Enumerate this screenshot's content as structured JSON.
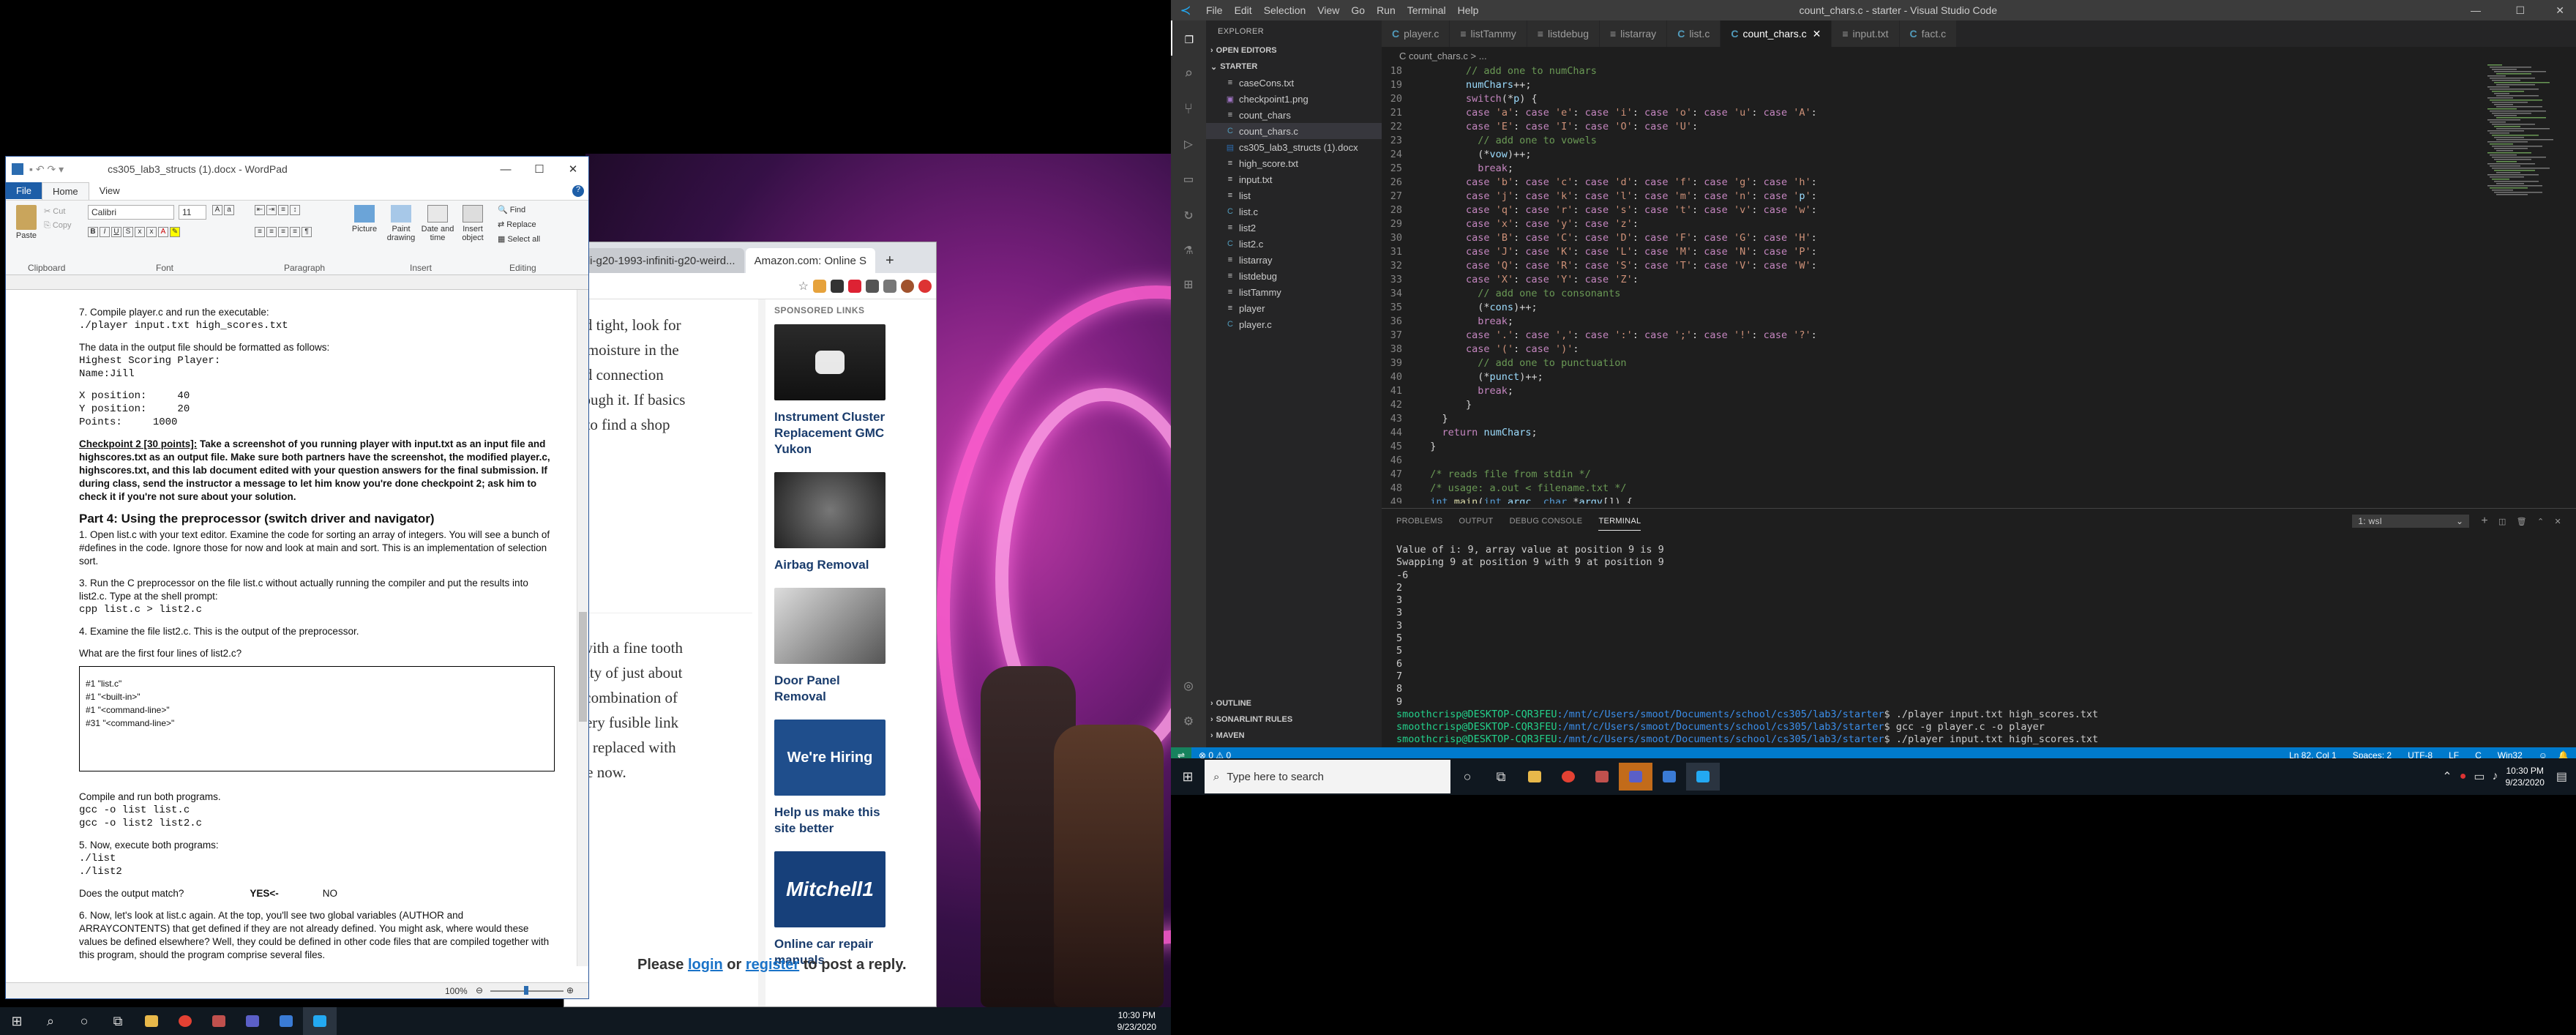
{
  "wordpad": {
    "title": "cs305_lab3_structs (1).docx - WordPad",
    "tabs": [
      "File",
      "Home",
      "View"
    ],
    "clipboard": {
      "paste": "Paste",
      "cut": "Cut",
      "copy": "Copy",
      "label": "Clipboard"
    },
    "font": {
      "family": "Calibri",
      "size": "11",
      "label": "Font"
    },
    "paragraph_label": "Paragraph",
    "insert": {
      "picture": "Picture",
      "paint": "Paint drawing",
      "datetime": "Date and time",
      "object": "Insert object",
      "label": "Insert"
    },
    "editing": {
      "find": "Find",
      "replace": "Replace",
      "select_all": "Select all",
      "label": "Editing"
    },
    "zoom": "100%",
    "doc": {
      "l1": "7. Compile player.c and run the executable:",
      "l2": "./player input.txt high_scores.txt",
      "l3": "The data in the output file should be formatted as follows:",
      "l4": "Highest Scoring Player:",
      "l5": "Name:Jill",
      "l6": "X position:     40",
      "l7": "Y position:     20",
      "l8": "Points:     1000",
      "cp_head": "Checkpoint 2 [30 points]:",
      "cp_body": " Take a screenshot of you running player with input.txt as an input file and highscores.txt as an output file. Make sure both partners have the screenshot, the modified player.c, highscores.txt, and this lab document edited with your question answers for the final submission. If during class, send the instructor a message to let him know you're done checkpoint 2; ask him to check it if you're not sure about your solution.",
      "part4": "Part 4: Using the preprocessor (switch driver and navigator)",
      "s1": "1. Open list.c with your text editor. Examine the code for sorting an array of integers. You will see a bunch of #defines in the code. Ignore those for now and look at main and sort. This is an implementation of selection sort.",
      "s3": "3. Run the C preprocessor on the file list.c without actually running the compiler and put the results into list2.c. Type at the shell prompt:",
      "s3cmd": "cpp list.c > list2.c",
      "s4": "4. Examine the file list2.c. This is the output of the preprocessor.",
      "q": "What are the first four lines of list2.c?",
      "ans": [
        "#1 \"list.c\"",
        "#1 \"<built-in>\"",
        "#1 \"<command-line>\"",
        "#31 \"<command-line>\""
      ],
      "compile": "Compile and run both programs.",
      "gcc1": "gcc -o list list.c",
      "gcc2": "gcc -o list2 list2.c",
      "s5": "5. Now, execute both programs:",
      "run1": "./list",
      "run2": "./list2",
      "match": "Does the output match?",
      "yes": "YES<-",
      "no": "NO",
      "s6": "6. Now, let's look at list.c again. At the top, you'll see two global variables (AUTHOR and ARRAYCONTENTS) that get defined if they are not already defined. You might ask, where would these values be defined elsewhere? Well, they could be defined in other code files that are compiled together with this program, should the program comprise several files."
    }
  },
  "browser": {
    "tabs": [
      "...ili-g20-1993-infiniti-g20-weird...",
      "Amazon.com: Online S"
    ],
    "article_lines": [
      "and tight, look for",
      "or moisture in the",
      "oad connection",
      "hrough it. If basics",
      "nt to find a shop"
    ],
    "article_lines2": [
      "g with a fine tooth",
      "nuity of just about",
      "A combination of",
      "attery fusible link",
      "ere replaced with",
      "line now."
    ],
    "sponsored": "SPONSORED LINKS",
    "ads": [
      "Instrument Cluster Replacement GMC Yukon",
      "Airbag Removal",
      "Door Panel Removal",
      "Help us make this site better",
      "Online car repair manuals"
    ],
    "hiring": "We're Hiring",
    "mitchell": "Mitchell1",
    "login": {
      "please": "Please ",
      "login": "login",
      "or": " or ",
      "register": "register",
      "rest": " to post a reply."
    }
  },
  "left_taskbar": {
    "time": "10:30 PM",
    "date": "9/23/2020"
  },
  "vscode": {
    "title": "count_chars.c - starter - Visual Studio Code",
    "menu": [
      "File",
      "Edit",
      "Selection",
      "View",
      "Go",
      "Run",
      "Terminal",
      "Help"
    ],
    "explorer_label": "EXPLORER",
    "open_editors": "OPEN EDITORS",
    "starter": "STARTER",
    "files": [
      "caseCons.txt",
      "checkpoint1.png",
      "count_chars",
      "count_chars.c",
      "cs305_lab3_structs (1).docx",
      "high_score.txt",
      "input.txt",
      "list",
      "list.c",
      "list2",
      "list2.c",
      "listarray",
      "listdebug",
      "listTammy",
      "player",
      "player.c"
    ],
    "outline": "OUTLINE",
    "sonarlint": "SONARLINT RULES",
    "maven": "MAVEN",
    "tabs": [
      "player.c",
      "listTammy",
      "listdebug",
      "listarray",
      "list.c",
      "count_chars.c",
      "input.txt",
      "fact.c"
    ],
    "breadcrumb": "C count_chars.c > ...",
    "code": [
      {
        "n": "18",
        "t": "        // add one to numChars"
      },
      {
        "n": "19",
        "t": "        numChars++;"
      },
      {
        "n": "20",
        "t": "        switch(*p) {"
      },
      {
        "n": "21",
        "t": "        case 'a': case 'e': case 'i': case 'o': case 'u': case 'A':"
      },
      {
        "n": "22",
        "t": "        case 'E': case 'I': case 'O': case 'U':"
      },
      {
        "n": "23",
        "t": "          // add one to vowels"
      },
      {
        "n": "24",
        "t": "          (*vow)++;"
      },
      {
        "n": "25",
        "t": "          break;"
      },
      {
        "n": "26",
        "t": "        case 'b': case 'c': case 'd': case 'f': case 'g': case 'h':"
      },
      {
        "n": "27",
        "t": "        case 'j': case 'k': case 'l': case 'm': case 'n': case 'p':"
      },
      {
        "n": "28",
        "t": "        case 'q': case 'r': case 's': case 't': case 'v': case 'w':"
      },
      {
        "n": "29",
        "t": "        case 'x': case 'y': case 'z':"
      },
      {
        "n": "30",
        "t": "        case 'B': case 'C': case 'D': case 'F': case 'G': case 'H':"
      },
      {
        "n": "31",
        "t": "        case 'J': case 'K': case 'L': case 'M': case 'N': case 'P':"
      },
      {
        "n": "32",
        "t": "        case 'Q': case 'R': case 'S': case 'T': case 'V': case 'W':"
      },
      {
        "n": "33",
        "t": "        case 'X': case 'Y': case 'Z':"
      },
      {
        "n": "34",
        "t": "          // add one to consonants"
      },
      {
        "n": "35",
        "t": "          (*cons)++;"
      },
      {
        "n": "36",
        "t": "          break;"
      },
      {
        "n": "37",
        "t": "        case '.': case ',': case ':': case ';': case '!': case '?':"
      },
      {
        "n": "38",
        "t": "        case '(': case ')':"
      },
      {
        "n": "39",
        "t": "          // add one to punctuation"
      },
      {
        "n": "40",
        "t": "          (*punct)++;"
      },
      {
        "n": "41",
        "t": "          break;"
      },
      {
        "n": "42",
        "t": "        }"
      },
      {
        "n": "43",
        "t": "    }"
      },
      {
        "n": "44",
        "t": "    return numChars;"
      },
      {
        "n": "45",
        "t": "  }"
      },
      {
        "n": "46",
        "t": ""
      },
      {
        "n": "47",
        "t": "  /* reads file from stdin */"
      },
      {
        "n": "48",
        "t": "  /* usage: a.out < filename.txt */"
      },
      {
        "n": "49",
        "t": "  int main(int argc, char *argv[]) {"
      }
    ],
    "panel_tabs": [
      "PROBLEMS",
      "OUTPUT",
      "DEBUG CONSOLE",
      "TERMINAL"
    ],
    "terminal_select": "1: wsl",
    "terminal": {
      "l1": "Value of i: 9, array value at position 9 is 9",
      "l2": "Swapping 9 at position 9 with 9 at position 9",
      "nums": [
        "-6",
        "2",
        "3",
        "3",
        "3",
        "5",
        "5",
        "6",
        "7",
        "8",
        "9"
      ],
      "prompt_user": "smoothcrisp@DESKTOP-CQR3FEU",
      "prompt_path": ":/mnt/c/Users/smoot/Documents/school/cs305/lab3/starter",
      "cmds": [
        "$ ./player input.txt high_scores.txt",
        "$ gcc -g player.c -o player",
        "$ ./player input.txt high_scores.txt",
        "$ "
      ]
    },
    "status": {
      "errors": "0",
      "warnings": "0",
      "position": "Ln 82, Col 1",
      "spaces": "Spaces: 2",
      "encoding": "UTF-8",
      "eol": "LF",
      "lang": "C",
      "platform": "Win32"
    }
  },
  "right_taskbar": {
    "search_placeholder": "Type here to search",
    "time": "10:30 PM",
    "date": "9/23/2020"
  }
}
